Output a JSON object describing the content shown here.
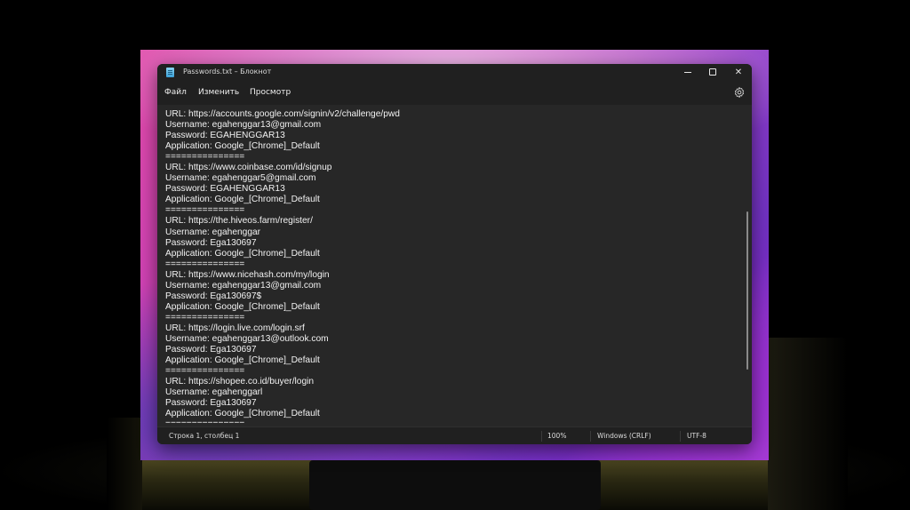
{
  "window": {
    "title": "Passwords.txt – Блокнот",
    "icon": "notepad-icon"
  },
  "controls": {
    "minimize_icon": "minimize-icon",
    "maximize_icon": "maximize-icon",
    "close_icon": "close-icon",
    "close_glyph": "✕"
  },
  "menu": {
    "file": "Файл",
    "edit": "Изменить",
    "view": "Просмотр",
    "settings_icon": "gear-icon"
  },
  "editor": {
    "lines": [
      "URL: https://accounts.google.com/signin/v2/challenge/pwd",
      "Username: egahenggar13@gmail.com",
      "Password: EGAHENGGAR13",
      "Application: Google_[Chrome]_Default",
      "===============",
      "URL: https://www.coinbase.com/id/signup",
      "Username: egahenggar5@gmail.com",
      "Password: EGAHENGGAR13",
      "Application: Google_[Chrome]_Default",
      "===============",
      "URL: https://the.hiveos.farm/register/",
      "Username: egahenggar",
      "Password: Ega130697",
      "Application: Google_[Chrome]_Default",
      "===============",
      "URL: https://www.nicehash.com/my/login",
      "Username: egahenggar13@gmail.com",
      "Password: Ega130697$",
      "Application: Google_[Chrome]_Default",
      "===============",
      "URL: https://login.live.com/login.srf",
      "Username: egahenggar13@outlook.com",
      "Password: Ega130697",
      "Application: Google_[Chrome]_Default",
      "===============",
      "URL: https://shopee.co.id/buyer/login",
      "Username: egahenggarl",
      "Password: Ega130697",
      "Application: Google_[Chrome]_Default",
      "==============="
    ]
  },
  "status": {
    "position": "Строка 1, столбец 1",
    "zoom": "100%",
    "line_ending": "Windows (CRLF)",
    "encoding": "UTF-8"
  }
}
